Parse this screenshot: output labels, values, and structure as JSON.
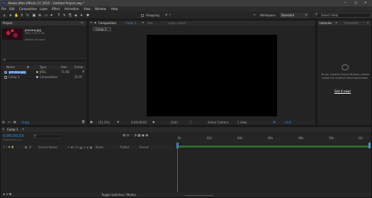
{
  "app": {
    "title": "Adobe After Effects CC 2015 - Untitled Project.aep *"
  },
  "menu": [
    "File",
    "Edit",
    "Composition",
    "Layer",
    "Effect",
    "Animation",
    "View",
    "Window",
    "Help"
  ],
  "toolbar": {
    "snapping": "Snapping",
    "workspace_label": "Workspace",
    "workspace_value": "Standard",
    "search_placeholder": "Search Help"
  },
  "project": {
    "tab": "Project",
    "thumb_name": "preview.jpg",
    "thumb_dims": "296 x 152 (1.00)",
    "thumb_colors": "Millions of Colors",
    "search_icon": "magnifier",
    "columns": [
      "Name",
      "Type",
      "Size",
      "Frame"
    ],
    "rows": [
      {
        "name": "preview.jpg",
        "type": "JPEG",
        "size": "75 KB",
        "frame": "",
        "selected": true
      },
      {
        "name": "Comp 1",
        "type": "Composition",
        "size": "",
        "frame": "25.97",
        "selected": false
      }
    ],
    "bpc": "8 bpc"
  },
  "composition": {
    "panel_label": "Composition",
    "comp_name": "Comp 1",
    "tabs_extra": [
      "Info",
      "Layer (none)"
    ],
    "sub_tab": "Comp 1",
    "footer": {
      "zoom": "(51.2%)",
      "timecode": "0;00;00;00",
      "resolution": "(Full)",
      "camera": "Active Camera",
      "view": "1 View",
      "value": "+0.0"
    }
  },
  "libraries": {
    "tabs": [
      "Libraries",
      "Character"
    ],
    "message": "To use Creative Cloud Libraries, please install the Creative Cloud Application",
    "link": "Get it now!"
  },
  "timeline": {
    "tab": "Comp 1",
    "timecode": "0;00;00;00",
    "fps": "00000 (29.97 fps)",
    "col_source": "Source Name",
    "col_mode": "Mode",
    "col_trkmat": "TrkMat",
    "col_parent": "Parent",
    "ruler": [
      "0s",
      "02s",
      "04s",
      "06s",
      "08s",
      "10s",
      "12s"
    ],
    "footer": "Toggle Switches / Modes"
  },
  "colors": {
    "accent": "#3c8ee8",
    "link": "#ffffff",
    "workarea": "#2d6e2a",
    "playhead": "#cc3333"
  }
}
